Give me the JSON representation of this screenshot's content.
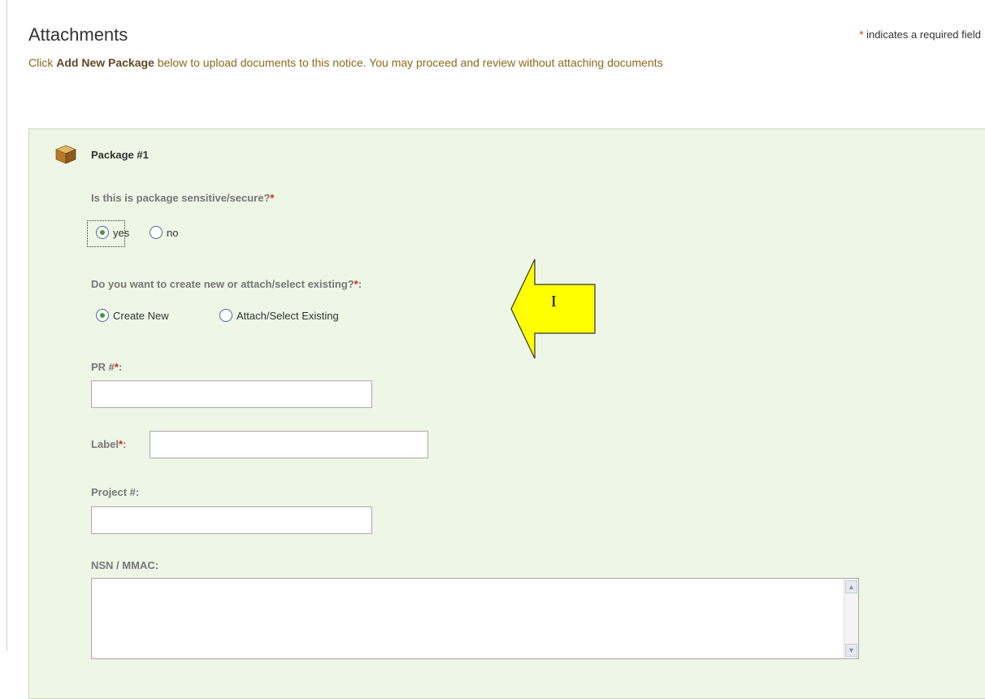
{
  "header": {
    "title": "Attachments",
    "required_star": "*",
    "required_note": " indicates a required field"
  },
  "intro": {
    "prefix": "Click ",
    "bold": "Add New Package",
    "suffix": " below to upload documents to this notice. You may proceed and review without attaching documents"
  },
  "package": {
    "icon": "package-box-icon",
    "title": "Package #1",
    "sensitive": {
      "question": "Is this is package sensitive/secure?",
      "star": "*",
      "options": [
        "yes",
        "no"
      ],
      "selected": "yes"
    },
    "create_mode": {
      "question": "Do you want to create new or attach/select existing?",
      "star": "*",
      "colon": ":",
      "options": [
        "Create New",
        "Attach/Select Existing"
      ],
      "selected": "Create New"
    },
    "fields": {
      "pr_label": "PR #",
      "pr_star": "*",
      "pr_colon": ":",
      "pr_value": "",
      "label_label": "Label",
      "label_star": "*",
      "label_colon": ":",
      "label_value": "",
      "project_label": "Project #:",
      "project_value": "",
      "nsn_label": "NSN / MMAC:",
      "nsn_value": ""
    }
  },
  "callout": {
    "label": "I",
    "fill_color": "#ffff00"
  },
  "colors": {
    "panel_bg": "#eef6e6",
    "intro_text": "#8a6a1c",
    "required_star": "#dd2211",
    "radio_dot": "#3e9b3c"
  }
}
